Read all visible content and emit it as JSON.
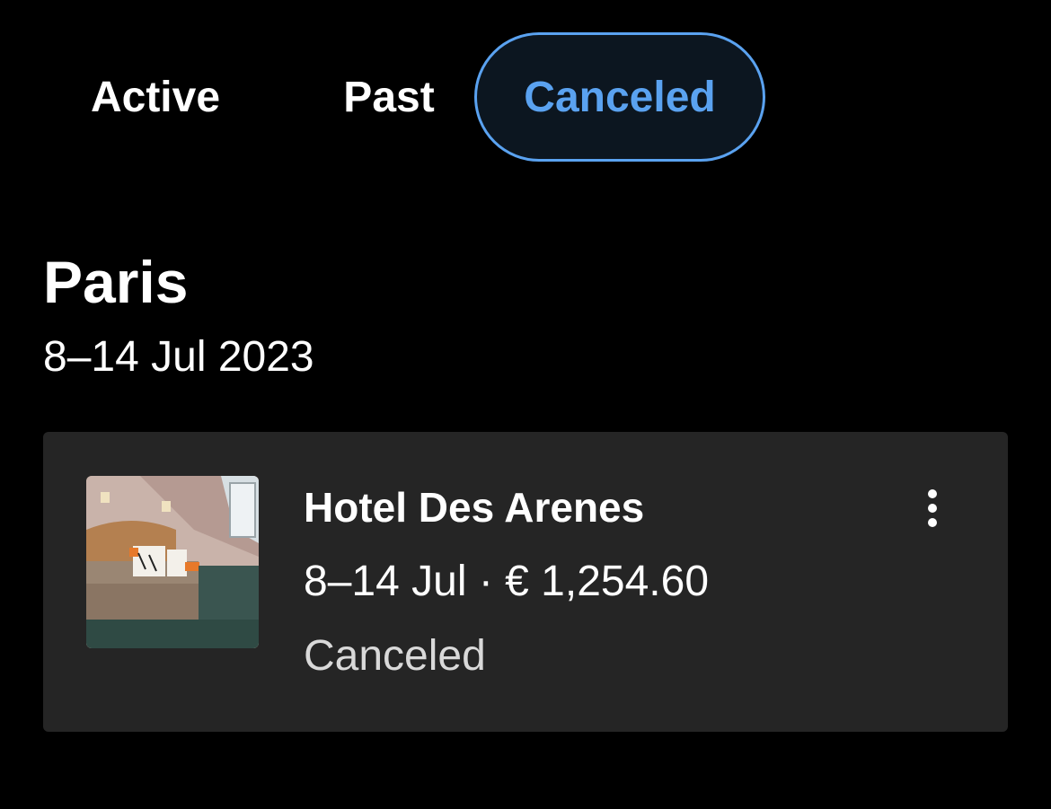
{
  "tabs": [
    {
      "label": "Active",
      "selected": false
    },
    {
      "label": "Past",
      "selected": false
    },
    {
      "label": "Canceled",
      "selected": true
    }
  ],
  "trip": {
    "city": "Paris",
    "dates": "8–14 Jul 2023"
  },
  "booking": {
    "hotel_name": "Hotel Des Arenes",
    "details": "8–14 Jul · € 1,254.60",
    "status": "Canceled",
    "thumbnail_icon": "hotel-room-photo",
    "more_icon": "more-vertical-icon"
  },
  "colors": {
    "background": "#000000",
    "card": "#252525",
    "accent": "#5aa2f0",
    "selected_tab_fill": "#0c1620",
    "status_text": "#d9d9d9"
  }
}
